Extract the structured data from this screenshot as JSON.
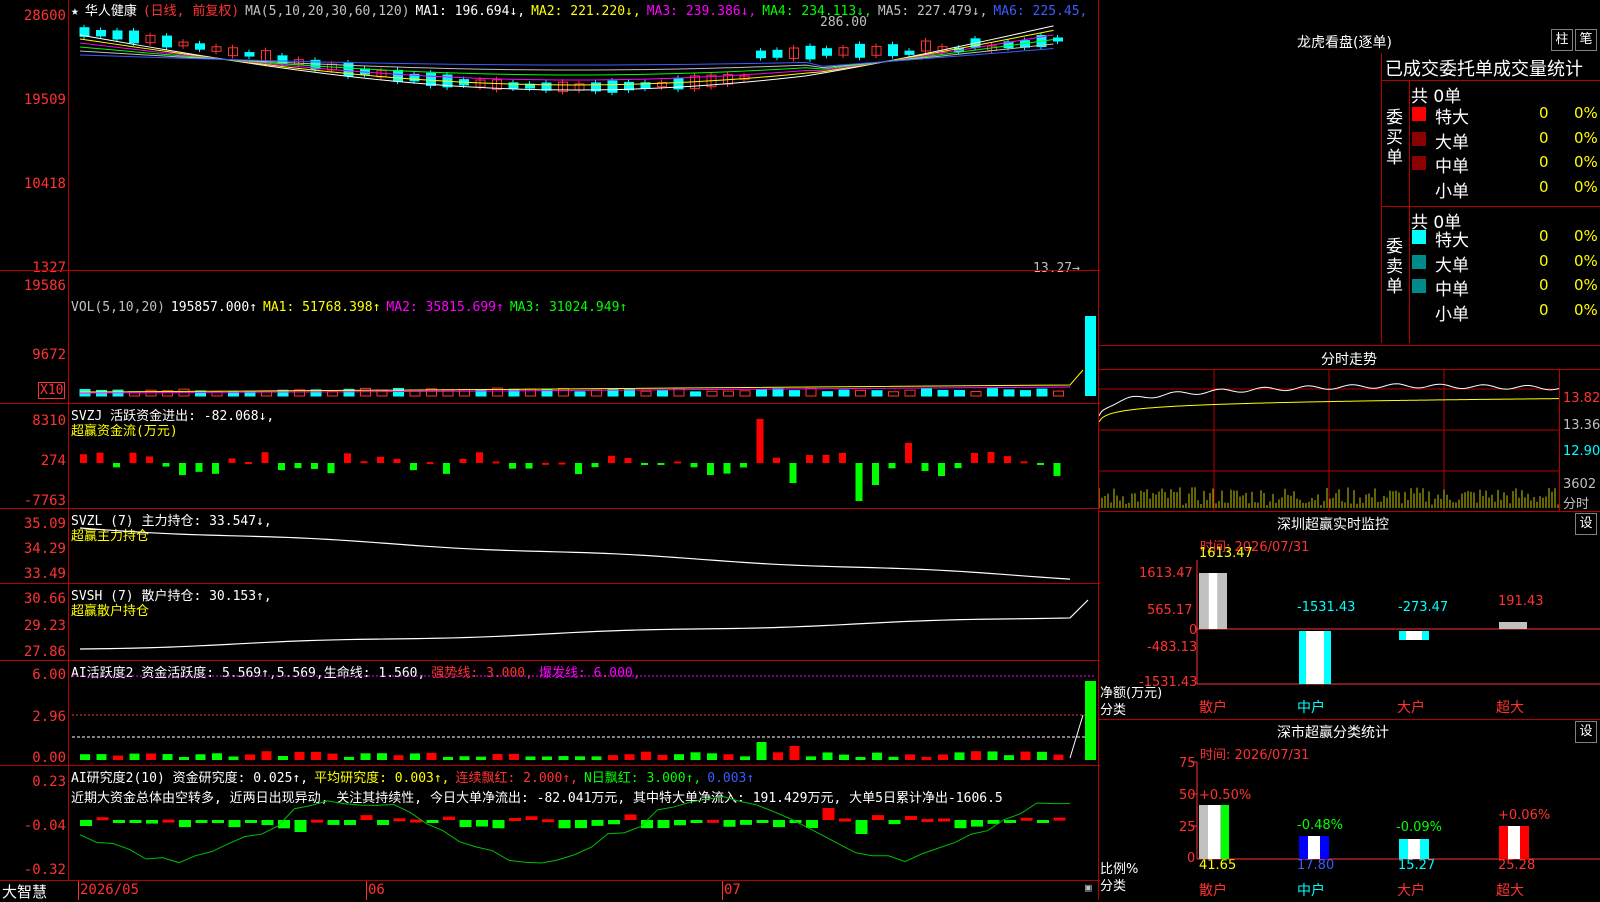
{
  "kline": {
    "stock_name": "华人健康",
    "period": "(日线, 前复权)",
    "ma_label": "MA(5,10,20,30,60,120)",
    "ma": [
      {
        "label": "MA1:",
        "value": "196.694↓",
        "color": "#ffffff"
      },
      {
        "label": "MA2:",
        "value": "221.220↓",
        "color": "#ffff00"
      },
      {
        "label": "MA3:",
        "value": "239.386↓",
        "color": "#ff00ff"
      },
      {
        "label": "MA4:",
        "value": "234.113↓",
        "color": "#00ff00"
      },
      {
        "label": "MA5:",
        "value": "227.479↓",
        "color": "#c0c0c0"
      },
      {
        "label": "MA6:",
        "value": "225.45",
        "color": "#3b5bff"
      }
    ],
    "y_labels": [
      "28600",
      "19509",
      "10418",
      "1327"
    ],
    "high_note": "286.00",
    "low_note": "13.27→"
  },
  "vol": {
    "label": "VOL(5,10,20)",
    "value": "195857.000↑",
    "ma1": "MA1: 51768.398↑",
    "ma2": "MA2: 35815.699↑",
    "ma3": "MA3: 31024.949↑",
    "y_labels": [
      "19586",
      "9672"
    ],
    "unit": "X10"
  },
  "svzj": {
    "label": "SVZJ  活跃资金进出: -82.068↓,",
    "sub": "超赢资金流(万元)",
    "y_labels": [
      "8310",
      "274",
      "-7763"
    ]
  },
  "svzl": {
    "label": "SVZL (7) 主力持仓: 33.547↓,",
    "sub": "超赢主力持仓",
    "y_labels": [
      "35.09",
      "34.29",
      "33.49"
    ]
  },
  "svsh": {
    "label": "SVSH (7) 散户持仓: 30.153↑,",
    "sub": "超赢散户持仓",
    "y_labels": [
      "30.66",
      "29.23",
      "27.86"
    ]
  },
  "ai_active": {
    "label": "AI活跃度2 资金活跃度: 5.569↑,5.569,生命线: 1.560,",
    "strong": "强势线: 3.000,",
    "burst": "爆发线: 6.000,",
    "y_labels": [
      "6.00",
      "2.96",
      "0.00"
    ]
  },
  "ai_research": {
    "label": "AI研究度2(10) 资金研究度: 0.025↑,",
    "avg": "平均研究度: 0.003↑,",
    "red": "连续飘红: 2.000↑,",
    "nday": "N日飘红: 3.000↑,",
    "extra": "0.003↑",
    "comment": "近期大资金总体由空转多, 近两日出现异动, 关注其持续性, 今日大单净流出: -82.041万元, 其中特大单净流入: 191.429万元, 大单5日累计净出-1606.5",
    "y_labels": [
      "0.23",
      "-0.04",
      "-0.32"
    ]
  },
  "bottom": {
    "brand": "大智慧",
    "dates": [
      "2026/05",
      "06",
      "07"
    ]
  },
  "right": {
    "title": "龙虎看盘(逐单)",
    "btn1": "柱",
    "btn2": "笔",
    "stat_title": "已成交委托单成交量统计",
    "buy_label": "委买单",
    "sell_label": "委卖单",
    "buy_total": "共 0单",
    "sell_total": "共 0单",
    "buy_rows": [
      {
        "name": "特大",
        "count": "0",
        "pct": "0%",
        "color": "#ff0000"
      },
      {
        "name": "大单",
        "count": "0",
        "pct": "0%",
        "color": "#8b0000"
      },
      {
        "name": "中单",
        "count": "0",
        "pct": "0%",
        "color": "#8b0000"
      },
      {
        "name": "小单",
        "count": "0",
        "pct": "0%",
        "color": "#000000"
      }
    ],
    "sell_rows": [
      {
        "name": "特大",
        "count": "0",
        "pct": "0%",
        "color": "#00ffff"
      },
      {
        "name": "大单",
        "count": "0",
        "pct": "0%",
        "color": "#008b8b"
      },
      {
        "name": "中单",
        "count": "0",
        "pct": "0%",
        "color": "#008b8b"
      },
      {
        "name": "小单",
        "count": "0",
        "pct": "0%",
        "color": "#000000"
      }
    ],
    "minute_title": "分时走势",
    "minute_y": [
      "13.82",
      "13.36",
      "12.90"
    ],
    "minute_vol": "3602",
    "minute_unit": "分时",
    "sz_title": "深圳超赢实时监控",
    "sz_set": "设",
    "sz_time": "时间: 2026/07/31",
    "sz_y": [
      "1613.47",
      "565.17",
      "0",
      "-483.13",
      "-1531.43"
    ],
    "sz_vals": [
      "1613.47",
      "-1531.43",
      "-273.47",
      "191.43"
    ],
    "sz_unit": "净额(万元)",
    "sz_cls": "分类",
    "cats": [
      "散户",
      "中户",
      "大户",
      "超大"
    ],
    "sc_title": "深市超赢分类统计",
    "sc_set": "设",
    "sc_time": "时间: 2026/07/31",
    "sc_y": [
      "75",
      "50",
      "25",
      "0"
    ],
    "sc_changes": [
      "+0.50%",
      "-0.48%",
      "-0.09%",
      "+0.06%"
    ],
    "sc_vals": [
      "41.65",
      "17.80",
      "15.27",
      "25.28"
    ],
    "sc_unit": "比例%",
    "sc_cls": "分类"
  }
}
